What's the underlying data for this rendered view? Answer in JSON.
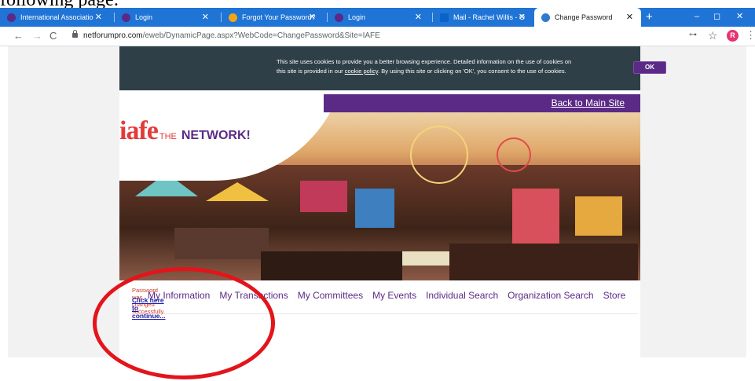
{
  "doc_fragment": "following page:",
  "tabs": [
    {
      "title": "International Associatio",
      "favicon_color": "#5b2a86"
    },
    {
      "title": "Login",
      "favicon_color": "#5b2a86"
    },
    {
      "title": "Forgot Your Password?",
      "favicon_color": "#f2a515"
    },
    {
      "title": "Login",
      "favicon_color": "#5b2a86"
    },
    {
      "title": "Mail - Rachel Willis - O",
      "favicon_color": "#0a64c8"
    },
    {
      "title": "Change Password",
      "favicon_color": "#2e7ad1",
      "active": true
    }
  ],
  "window_controls": {
    "minimize": "–",
    "restore": "◻",
    "close": "✕"
  },
  "address": {
    "host": "netforumpro.com",
    "path": "/eweb/DynamicPage.aspx?WebCode=ChangePassword&Site=IAFE"
  },
  "profile_initial": "R",
  "cookie_banner": {
    "line1": "This site uses cookies to provide you a better browsing experience. Detailed information on the use of cookies on",
    "line2_pre": "this site is provided in our ",
    "line2_link": "cookie policy",
    "line2_post": ". By using this site or clicking on 'OK', you consent to the use of cookies.",
    "ok_label": "OK"
  },
  "header": {
    "back_link": "Back to Main Site",
    "logo_iafe": "iafe",
    "logo_the": "THE",
    "logo_network": "NETWORK!"
  },
  "nav": [
    "My Information",
    "My Transactions",
    "My Committees",
    "My Events",
    "Individual Search",
    "Organization Search",
    "Store"
  ],
  "message": "Password was changed successfully.",
  "continue_link": "Click here to continue...",
  "colors": {
    "brand_purple": "#5b2a86",
    "tab_blue": "#1f74d6",
    "annotation_red": "#e3141b",
    "success_text": "#d23b2a"
  }
}
